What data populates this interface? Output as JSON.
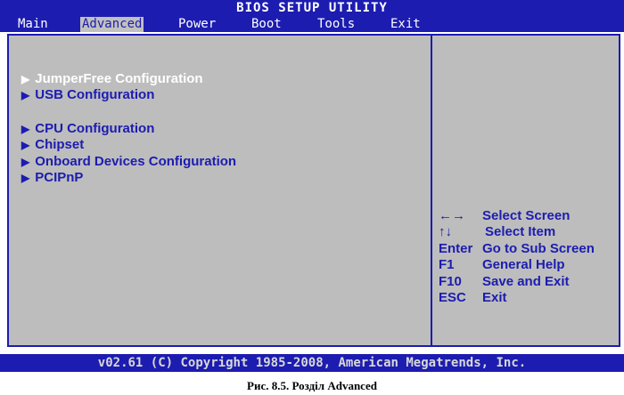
{
  "title": "BIOS SETUP UTILITY",
  "menu": {
    "tabs": [
      {
        "label": "Main"
      },
      {
        "label": "Advanced"
      },
      {
        "label": "Power"
      },
      {
        "label": "Boot"
      },
      {
        "label": "Tools"
      },
      {
        "label": "Exit"
      }
    ],
    "active": "Advanced"
  },
  "items": [
    {
      "label": "JumperFree Configuration",
      "selected": true
    },
    {
      "label": "USB Configuration"
    },
    {
      "label": "CPU Configuration"
    },
    {
      "label": "Chipset"
    },
    {
      "label": "Onboard Devices Configuration"
    },
    {
      "label": "PCIPnP"
    }
  ],
  "help": [
    {
      "key": "←→",
      "desc": "Select Screen"
    },
    {
      "key": "↑↓",
      "desc": "Select Item"
    },
    {
      "key": "Enter",
      "desc": "Go to Sub Screen"
    },
    {
      "key": "F1",
      "desc": "General Help"
    },
    {
      "key": "F10",
      "desc": "Save and Exit"
    },
    {
      "key": "ESC",
      "desc": "Exit"
    }
  ],
  "footer": "v02.61 (C) Copyright 1985-2008, American Megatrends, Inc.",
  "caption": "Рис. 8.5. Розділ Advanced",
  "colors": {
    "bios_blue": "#1c1cb0",
    "panel_gray": "#bdbdbd",
    "tab_active_bg": "#c0c0c0"
  }
}
